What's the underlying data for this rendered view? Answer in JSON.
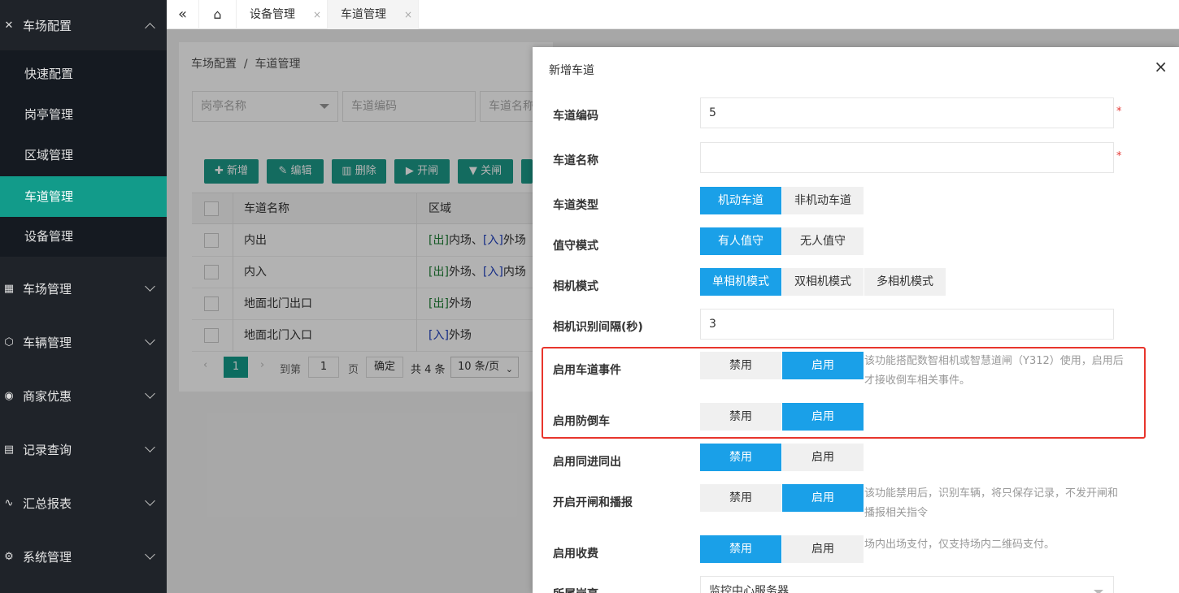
{
  "sidebar": {
    "groups": [
      {
        "icon": "tools-icon",
        "glyph": "✕",
        "label": "车场配置"
      },
      {
        "icon": "grid-icon",
        "glyph": "▦",
        "label": "车场管理"
      },
      {
        "icon": "cube-icon",
        "glyph": "⬡",
        "label": "车辆管理"
      },
      {
        "icon": "coupon-icon",
        "glyph": "◉",
        "label": "商家优惠"
      },
      {
        "icon": "clipboard-icon",
        "glyph": "▤",
        "label": "记录查询"
      },
      {
        "icon": "pulse-icon",
        "glyph": "∿",
        "label": "汇总报表"
      },
      {
        "icon": "gear-icon",
        "glyph": "⚙",
        "label": "系统管理"
      }
    ],
    "sub_items": [
      "快速配置",
      "岗亭管理",
      "区域管理",
      "车道管理",
      "设备管理"
    ]
  },
  "topbar": {
    "tabs": [
      {
        "label": "设备管理"
      },
      {
        "label": "车道管理"
      }
    ],
    "close_glyph": "×"
  },
  "background": {
    "breadcrumb": "车场配置  /  车道管理",
    "filters": {
      "booth_placeholder": "岗亭名称",
      "code_placeholder": "车道编码",
      "name_placeholder": "车道名称"
    },
    "toolbar": {
      "add": "新增",
      "edit": "编辑",
      "delete": "删除",
      "open": "开闸",
      "close": "关闸"
    },
    "table": {
      "headers": [
        "车道名称",
        "区域"
      ],
      "rows": [
        {
          "name": "内出",
          "a1": "[出]",
          "z1": "内场、",
          "a2": "[入]",
          "z2": "外场"
        },
        {
          "name": "内入",
          "a1": "[出]",
          "z1": "外场、",
          "a2": "[入]",
          "z2": "内场"
        },
        {
          "name": "地面北门出口",
          "a1": "[出]",
          "z1": "外场",
          "a2": "",
          "z2": ""
        },
        {
          "name": "地面北门入口",
          "a1": "[入]",
          "z1": "外场",
          "a2": "",
          "z2": ""
        }
      ]
    },
    "pager": {
      "current": "1",
      "goto_prefix": "到第",
      "goto_value": "1",
      "goto_suffix": "页",
      "confirm": "确定",
      "total": "共 4 条",
      "page_size": "10 条/页"
    }
  },
  "dialog": {
    "title": "新增车道",
    "close_glyph": "×",
    "fields": {
      "lane_code": {
        "label": "车道编码",
        "value": "5"
      },
      "lane_name": {
        "label": "车道名称",
        "value": ""
      },
      "lane_type": {
        "label": "车道类型",
        "options": [
          "机动车道",
          "非机动车道"
        ],
        "selected": 0
      },
      "duty_mode": {
        "label": "值守模式",
        "options": [
          "有人值守",
          "无人值守"
        ],
        "selected": 0
      },
      "camera_mode": {
        "label": "相机模式",
        "options": [
          "单相机模式",
          "双相机模式",
          "多相机模式"
        ],
        "selected": 0
      },
      "recognize_interval": {
        "label": "相机识别间隔(秒)",
        "value": "3"
      },
      "lane_event": {
        "label": "启用车道事件",
        "options": [
          "禁用",
          "启用"
        ],
        "selected": 1,
        "hint": "该功能搭配数智相机或智慧道闸（Y312）使用，启用后才接收倒车相关事件。"
      },
      "anti_reverse": {
        "label": "启用防倒车",
        "options": [
          "禁用",
          "启用"
        ],
        "selected": 1
      },
      "sync_in_out": {
        "label": "启用同进同出",
        "options": [
          "禁用",
          "启用"
        ],
        "selected": 0
      },
      "open_broadcast": {
        "label": "开启开闸和播报",
        "options": [
          "禁用",
          "启用"
        ],
        "selected": 1,
        "hint": "该功能禁用后，识别车辆，将只保存记录，不发开闸和播报相关指令"
      },
      "charging": {
        "label": "启用收费",
        "options": [
          "禁用",
          "启用"
        ],
        "selected": 0,
        "hint": "场内出场支付，仅支持场内二维码支付。"
      },
      "booth": {
        "label": "所属岗亭",
        "value": "监控中心服务器"
      }
    },
    "required_mark": "*"
  },
  "colors": {
    "accent": "#1aa0e8",
    "sidebar_active": "#129b8a",
    "highlight_box": "#e8352c"
  }
}
